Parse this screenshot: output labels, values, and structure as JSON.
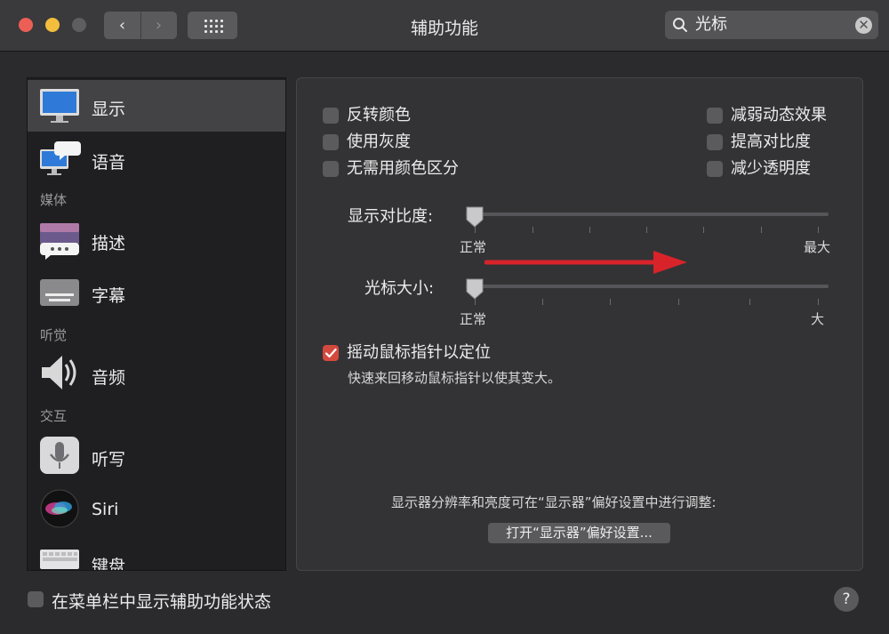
{
  "window": {
    "title": "辅助功能",
    "back_glyph": "‹",
    "forward_glyph": "›"
  },
  "search": {
    "value": "光标",
    "icon": "search-icon",
    "clear_icon": "clear-icon",
    "clear_glyph": "✕"
  },
  "sidebar": {
    "items": [
      {
        "label": "显示",
        "icon": "display-icon",
        "selected": true
      },
      {
        "label": "语音",
        "icon": "speech-icon"
      },
      {
        "label": "描述",
        "icon": "descriptions-icon"
      },
      {
        "label": "字幕",
        "icon": "captions-icon"
      },
      {
        "label": "音频",
        "icon": "speaker-icon"
      },
      {
        "label": "听写",
        "icon": "microphone-icon"
      },
      {
        "label": "Siri",
        "icon": "siri-icon"
      },
      {
        "label": "键盘",
        "icon": "keyboard-icon"
      }
    ],
    "categories": [
      "媒体",
      "听觉",
      "交互"
    ]
  },
  "options": {
    "invert_colors": "反转颜色",
    "grayscale": "使用灰度",
    "differentiate": "无需用颜色区分",
    "reduce_motion": "减弱动态效果",
    "increase_contrast": "提高对比度",
    "reduce_transparency": "减少透明度"
  },
  "contrast_slider": {
    "label": "显示对比度:",
    "min_label": "正常",
    "max_label": "最大",
    "value": 0
  },
  "cursor_slider": {
    "label": "光标大小:",
    "min_label": "正常",
    "max_label": "大",
    "value": 0
  },
  "shake": {
    "label": "摇动鼠标指针以定位",
    "checked": true,
    "description": "快速来回移动鼠标指针以使其变大。"
  },
  "footer_note": "显示器分辨率和亮度可在“显示器”偏好设置中进行调整:",
  "open_button": "打开“显示器”偏好设置...",
  "bottom": {
    "status_label": "在菜单栏中显示辅助功能状态",
    "help": "?"
  },
  "colors": {
    "accent_checked": "#d4493e",
    "annotation_arrow": "#d9232a"
  }
}
